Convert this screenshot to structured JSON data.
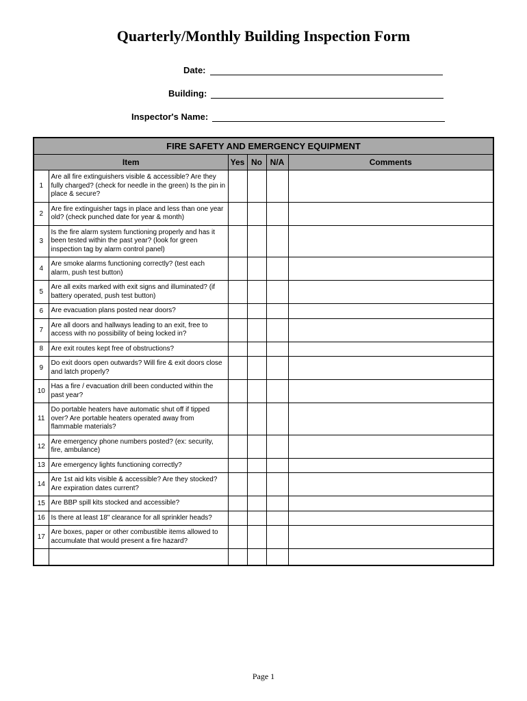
{
  "title": "Quarterly/Monthly Building Inspection Form",
  "fields": {
    "date_label": "Date:",
    "building_label": "Building:",
    "inspector_label": "Inspector's Name:"
  },
  "section_title": "FIRE SAFETY AND EMERGENCY EQUIPMENT",
  "columns": {
    "item": "Item",
    "yes": "Yes",
    "no": "No",
    "na": "N/A",
    "comments": "Comments"
  },
  "items": [
    {
      "num": "1",
      "text": "Are all fire extinguishers visible & accessible?  Are they fully charged? (check for needle in the green)  Is the pin in place & secure?"
    },
    {
      "num": "2",
      "text": "Are fire extinguisher tags in place and less than one year old? (check punched date for year & month)"
    },
    {
      "num": "3",
      "text": "Is the fire alarm system functioning properly and has it been tested within the past year? (look for green inspection tag by alarm control panel)"
    },
    {
      "num": "4",
      "text": "Are smoke alarms functioning correctly? (test each alarm, push test button)"
    },
    {
      "num": "5",
      "text": "Are all exits marked with exit signs and illuminated? (if battery operated, push test button)"
    },
    {
      "num": "6",
      "text": "Are evacuation plans posted near doors?"
    },
    {
      "num": "7",
      "text": "Are all doors and hallways leading to an exit, free to access with no possibility of being locked in?"
    },
    {
      "num": "8",
      "text": "Are exit routes kept free of obstructions?"
    },
    {
      "num": "9",
      "text": "Do exit doors open outwards?  Will fire & exit doors close and latch properly?"
    },
    {
      "num": "10",
      "text": "Has a fire / evacuation drill been conducted within the past year?"
    },
    {
      "num": "11",
      "text": "Do portable heaters have automatic shut off if tipped over? Are portable heaters operated away from flammable materials?"
    },
    {
      "num": "12",
      "text": "Are emergency phone numbers posted? (ex: security, fire, ambulance)"
    },
    {
      "num": "13",
      "text": "Are emergency lights functioning correctly?"
    },
    {
      "num": "14",
      "text": "Are 1st aid kits visible & accessible? Are they stocked? Are expiration dates current?"
    },
    {
      "num": "15",
      "text": "Are BBP spill kits stocked and accessible?"
    },
    {
      "num": "16",
      "text": "Is there at least 18\" clearance for all sprinkler heads?"
    },
    {
      "num": "17",
      "text": "Are boxes, paper or other combustible items allowed to accumulate that would present a fire hazard?"
    }
  ],
  "footer": "Page 1"
}
